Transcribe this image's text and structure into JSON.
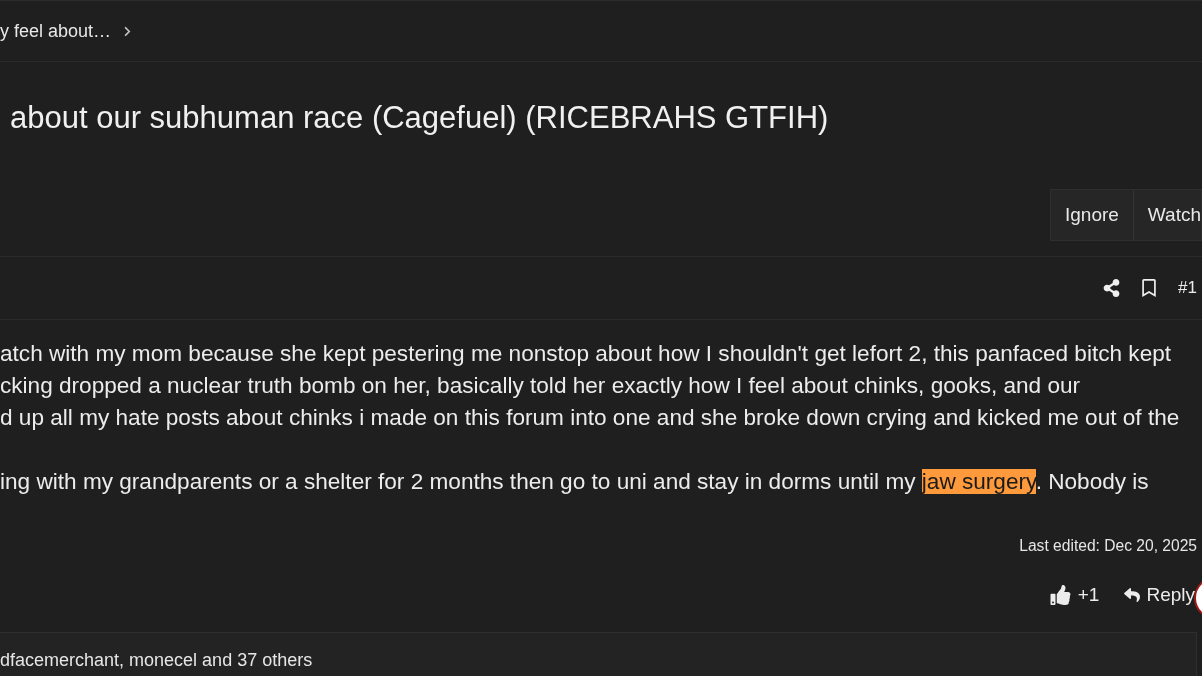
{
  "breadcrumb": {
    "label": "y feel about…"
  },
  "thread": {
    "title": "about our subhuman race (Cagefuel) (RICEBRAHS GTFIH)",
    "actions": [
      "Ignore",
      "Watch"
    ]
  },
  "post": {
    "number": "#1",
    "paragraphs": [
      {
        "lines": [
          [
            {
              "text": "atch with my mom because she kept pestering me nonstop about how I shouldn't get lefort 2, this panfaced bitch kept",
              "highlighted": false
            }
          ],
          [
            {
              "text": "cking dropped a nuclear truth bomb on her, basically told her exactly how I feel about chinks, gooks, and our",
              "highlighted": false
            }
          ],
          [
            {
              "text": "d up all my hate posts about chinks i made on this forum into one and she broke down crying and kicked me out of the",
              "highlighted": false
            }
          ]
        ]
      },
      {
        "lines": [
          [
            {
              "text": "ing with my grandparents or a shelter for 2 months then go to uni and stay in dorms until my ",
              "highlighted": false
            },
            {
              "text": "jaw surgery",
              "highlighted": true
            },
            {
              "text": ". Nobody is",
              "highlighted": false
            }
          ]
        ]
      }
    ],
    "last_edited": "Last edited: Dec 20, 2025",
    "reaction_count": "+1",
    "reply_label": "Reply"
  },
  "reactions_bar": {
    "text": "dfacemerchant, monecel and 37 others"
  }
}
